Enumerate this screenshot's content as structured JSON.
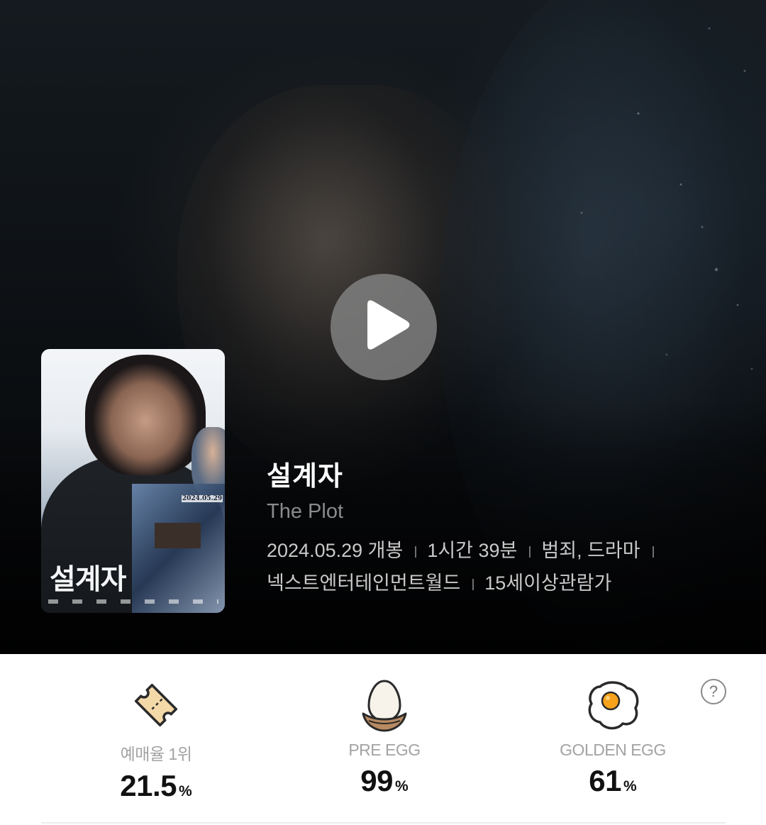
{
  "movie": {
    "title": "설계자",
    "english_title": "The Plot",
    "release": "2024.05.29 개봉",
    "runtime": "1시간 39분",
    "genre": "범죄, 드라마",
    "distributor": "넥스트엔터테인먼트월드",
    "rating": "15세이상관람가"
  },
  "poster": {
    "title_text": "설계자",
    "date_text": "2024.05.29"
  },
  "player": {
    "play_icon": "play-icon"
  },
  "stats": {
    "reservation": {
      "label": "예매율 1위",
      "value": "21.5",
      "unit": "%",
      "icon": "ticket-icon"
    },
    "pre_egg": {
      "label": "PRE EGG",
      "value": "99",
      "unit": "%",
      "icon": "egg-nest-icon"
    },
    "golden_egg": {
      "label": "GOLDEN EGG",
      "value": "61",
      "unit": "%",
      "icon": "fried-egg-icon"
    },
    "help": "?"
  },
  "colors": {
    "hero_bg": "#0b0e11",
    "accent_ticket": "#f4d9a8",
    "accent_yolk": "#f7a21b",
    "label_gray": "#a3a3a3"
  }
}
